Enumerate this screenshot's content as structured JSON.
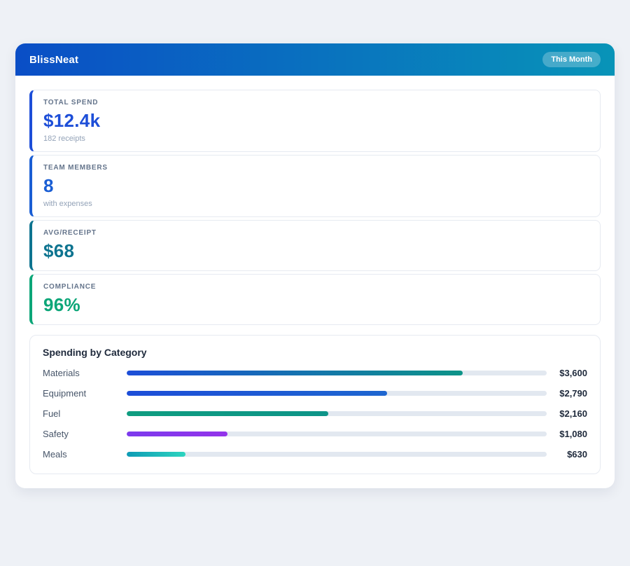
{
  "theme": {
    "header_gradient_from": "#0a4ec6",
    "header_gradient_to": "#0894b8"
  },
  "header": {
    "title": "BlissNeat",
    "badge": "This Month"
  },
  "stats": [
    {
      "label": "TOTAL SPEND",
      "value": "$12.4k",
      "sub": "182 receipts",
      "accent": "#1d4ed8"
    },
    {
      "label": "TEAM MEMBERS",
      "value": "8",
      "sub": "with expenses",
      "accent": "#1a5ed4"
    },
    {
      "label": "AVG/RECEIPT",
      "value": "$68",
      "sub": "",
      "accent": "#0e7490"
    },
    {
      "label": "COMPLIANCE",
      "value": "96%",
      "sub": "",
      "accent": "#0ca678"
    }
  ],
  "chart_data": {
    "type": "bar",
    "title": "Spending by Category",
    "categories": [
      "Materials",
      "Equipment",
      "Fuel",
      "Safety",
      "Meals"
    ],
    "values": [
      3600,
      2790,
      2160,
      1080,
      630
    ],
    "value_labels": [
      "$3,600",
      "$2,790",
      "$2,160",
      "$1,080",
      "$630"
    ],
    "xlabel": "",
    "ylabel": "",
    "xlim": [
      0,
      4500
    ],
    "grid": false,
    "legend": "none",
    "colors": [
      {
        "from": "#1d4ed8",
        "to": "#0d9488"
      },
      {
        "from": "#1d4ed8",
        "to": "#1e66d0"
      },
      {
        "from": "#0f9d80",
        "to": "#0d9488"
      },
      {
        "from": "#7c3aed",
        "to": "#9333ea"
      },
      {
        "from": "#0e9bb5",
        "to": "#2dd4bf"
      }
    ]
  }
}
